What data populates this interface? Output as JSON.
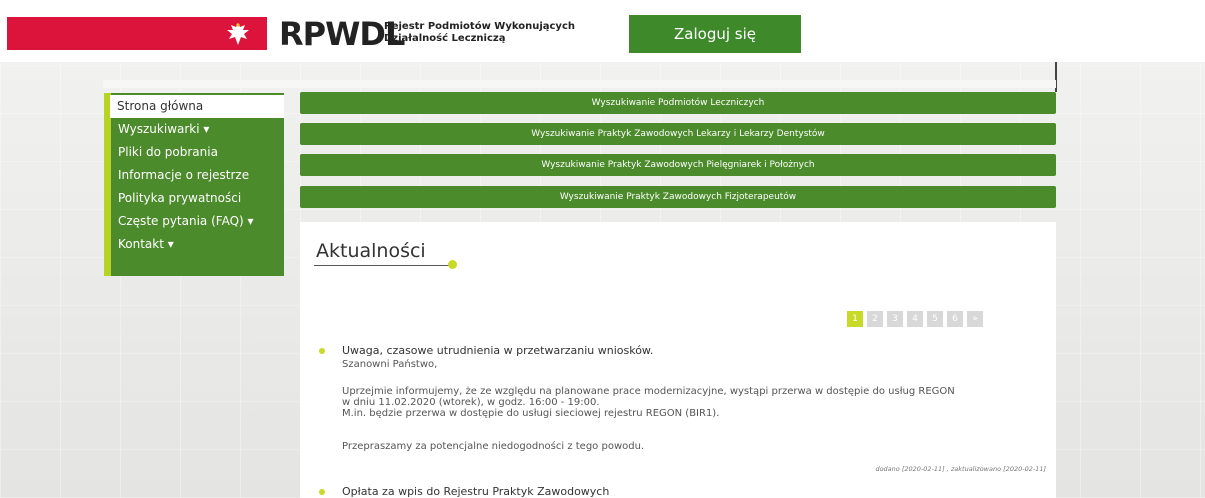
{
  "header": {
    "logo_main": "RPWDL",
    "logo_sub_line1": "Rejestr Podmiotów Wykonujących",
    "logo_sub_line2": "Działalność Leczniczą",
    "login_label": "Zaloguj się",
    "brand_red": "#dc143c",
    "accent_green": "#3e8a2a"
  },
  "sidebar": {
    "items": [
      {
        "label": "Strona główna"
      },
      {
        "label": "Wyszukiwarki ▾"
      },
      {
        "label": "Pliki do pobrania"
      },
      {
        "label": "Informacje o rejestrze"
      },
      {
        "label": "Polityka prywatności"
      },
      {
        "label": "Częste pytania (FAQ) ▾"
      },
      {
        "label": "Kontakt ▾"
      }
    ]
  },
  "search_buttons": [
    {
      "label": "Wyszukiwanie Podmiotów Leczniczych"
    },
    {
      "label": "Wyszukiwanie Praktyk Zawodowych Lekarzy i Lekarzy Dentystów"
    },
    {
      "label": "Wyszukiwanie Praktyk Zawodowych Pielęgniarek i Położnych"
    },
    {
      "label": "Wyszukiwanie Praktyk Zawodowych Fizjoterapeutów"
    }
  ],
  "news": {
    "title": "Aktualności",
    "pages": [
      "1",
      "2",
      "3",
      "4",
      "5",
      "6",
      "»"
    ],
    "articles": [
      {
        "title": "Uwaga, czasowe utrudnienia w przetwarzaniu wniosków.",
        "greeting": "Szanowni Państwo,",
        "p1_line1": "Uprzejmie informujemy, że ze względu na planowane prace modernizacyjne, wystąpi przerwa w dostępie do usług REGON",
        "p1_line2": "w dniu 11.02.2020 (wtorek), w godz. 16:00 - 19:00.",
        "p1_line3": "M.in. będzie przerwa w dostępie do usługi sieciowej rejestru REGON (BIR1).",
        "p2": "Przepraszamy za potencjalne niedogodności z tego powodu.",
        "meta": "dodano [2020-02-11] , zaktualizowano [2020-02-11]"
      },
      {
        "title": "Opłata za wpis do Rejestru Praktyk Zawodowych"
      }
    ]
  }
}
